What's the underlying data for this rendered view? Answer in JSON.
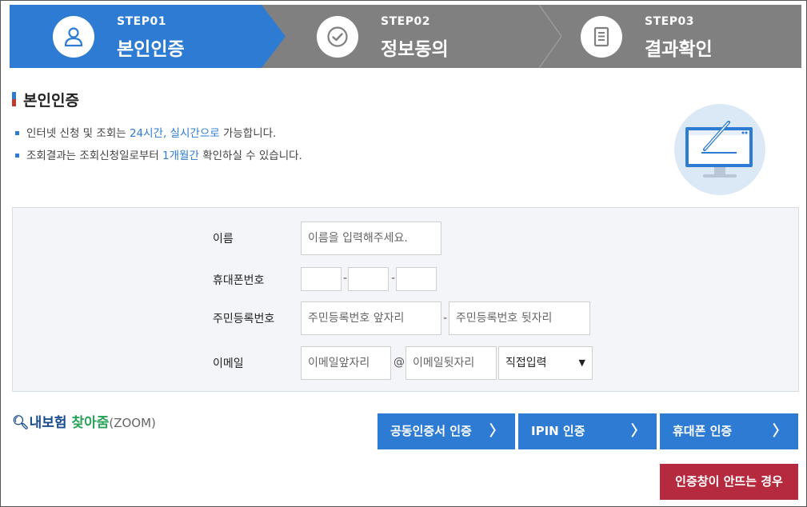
{
  "steps": [
    {
      "no": "STEP01",
      "label": "본인인증",
      "icon": "person-icon"
    },
    {
      "no": "STEP02",
      "label": "정보동의",
      "icon": "check-icon"
    },
    {
      "no": "STEP03",
      "label": "결과확인",
      "icon": "document-icon"
    }
  ],
  "section": {
    "title": "본인인증",
    "bullet1": {
      "a": "인터넷 신청 및 조회는 ",
      "b": "24시간, 실시간으로",
      "c": " 가능합니다."
    },
    "bullet2": {
      "a": "조회결과는 조회신청일로부터 ",
      "b": "1개월간",
      "c": " 확인하실 수 있습니다."
    }
  },
  "form": {
    "name_label": "이름",
    "name_placeholder": "이름을 입력해주세요.",
    "phone_label": "휴대폰번호",
    "rrn_label": "주민등록번호",
    "rrn_front_placeholder": "주민등록번호 앞자리",
    "rrn_back_placeholder": "주민등록번호 뒷자리",
    "email_label": "이메일",
    "email_front_placeholder": "이메일앞자리",
    "at": "@",
    "email_back_placeholder": "이메일뒷자리",
    "domain_select": "직접입력",
    "dash": "-"
  },
  "zoom": {
    "a": "내보험 ",
    "b": "찾아줌",
    "c": "(ZOOM)"
  },
  "buttons": {
    "cert": "공동인증서 인증",
    "ipin": "IPIN 인증",
    "phone": "휴대폰 인증",
    "help": "인증창이 안뜨는 경우",
    "arrow": "〉"
  },
  "colors": {
    "accent": "#2d7bd2",
    "inactive": "#808080",
    "danger": "#b52a3e"
  }
}
